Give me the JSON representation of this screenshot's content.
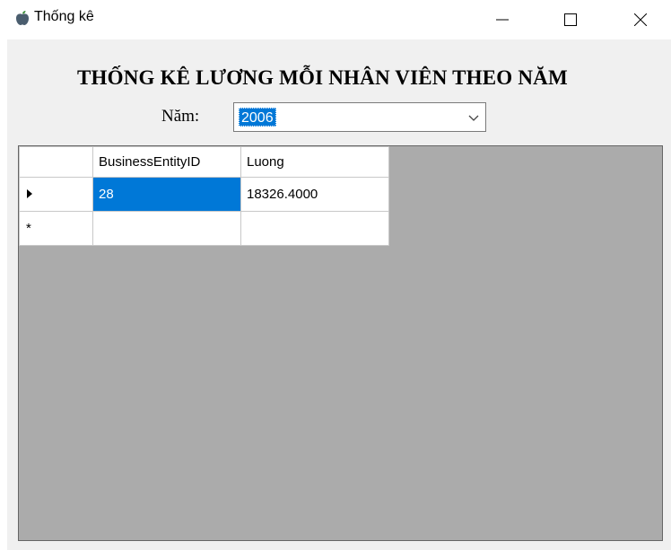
{
  "window": {
    "title": "Thống kê",
    "icon": "apple-icon",
    "controls": [
      "minimize-icon",
      "maximize-icon",
      "close-icon"
    ]
  },
  "form": {
    "heading": "THỐNG KÊ LƯƠNG MỖI NHÂN VIÊN THEO NĂM",
    "year_label": "Năm:",
    "year_value": "2006"
  },
  "grid": {
    "columns": [
      "BusinessEntityID",
      "Luong"
    ],
    "rows": [
      {
        "id": "28",
        "luong": "18326.4000",
        "current": true
      }
    ],
    "new_row_marker": "*"
  },
  "colors": {
    "selection": "#0078d7",
    "grid_background": "#ababab",
    "form_background": "#f0f0f0"
  }
}
